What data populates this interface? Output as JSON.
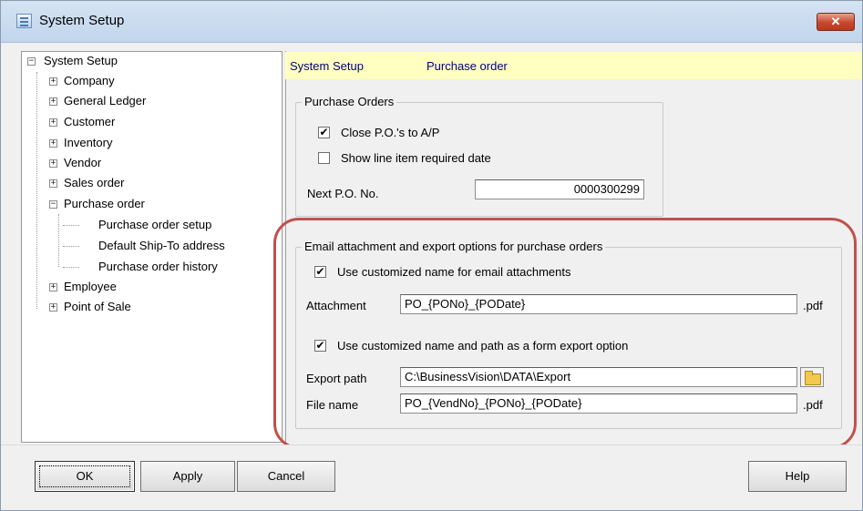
{
  "window": {
    "title": "System Setup",
    "close_label": "✕"
  },
  "tree": {
    "root": "System Setup",
    "items": [
      {
        "label": "Company",
        "expander": "+"
      },
      {
        "label": "General Ledger",
        "expander": "+"
      },
      {
        "label": "Customer",
        "expander": "+"
      },
      {
        "label": "Inventory",
        "expander": "+"
      },
      {
        "label": "Vendor",
        "expander": "+"
      },
      {
        "label": "Sales order",
        "expander": "+"
      },
      {
        "label": "Purchase order",
        "expander": "−"
      },
      {
        "label": "Purchase order setup"
      },
      {
        "label": "Default Ship-To address"
      },
      {
        "label": "Purchase order history"
      },
      {
        "label": "Employee",
        "expander": "+"
      },
      {
        "label": "Point of Sale",
        "expander": "+"
      }
    ],
    "root_expander": "−"
  },
  "header": {
    "section": "System Setup",
    "page": "Purchase order"
  },
  "purchase_orders": {
    "legend": "Purchase Orders",
    "close_po_label": "Close P.O.'s to A/P",
    "close_po_checked": "✔",
    "show_line_label": "Show line item required date",
    "show_line_checked": "",
    "next_po_label": "Next P.O. No.",
    "next_po_value": "0000300299"
  },
  "email_export": {
    "legend": "Email attachment and export options for purchase orders",
    "custom_email_label": "Use customized name for email attachments",
    "custom_email_checked": "✔",
    "attachment_label": "Attachment",
    "attachment_value": "PO_{PONo}_{PODate}",
    "attachment_ext": ".pdf",
    "custom_export_label": "Use customized name and path as a form export option",
    "custom_export_checked": "✔",
    "export_path_label": "Export path",
    "export_path_value": "C:\\BusinessVision\\DATA\\Export",
    "file_name_label": "File name",
    "file_name_value": "PO_{VendNo}_{PONo}_{PODate}",
    "file_name_ext": ".pdf"
  },
  "buttons": {
    "ok": "OK",
    "apply": "Apply",
    "cancel": "Cancel",
    "help": "Help"
  },
  "colors": {
    "highlight_ring": "#c0504d",
    "header_strip": "#ffffc0",
    "header_text": "#00007a"
  },
  "icons": {
    "folder": "folder-icon",
    "app": "system-setup-icon",
    "close": "close-icon"
  }
}
